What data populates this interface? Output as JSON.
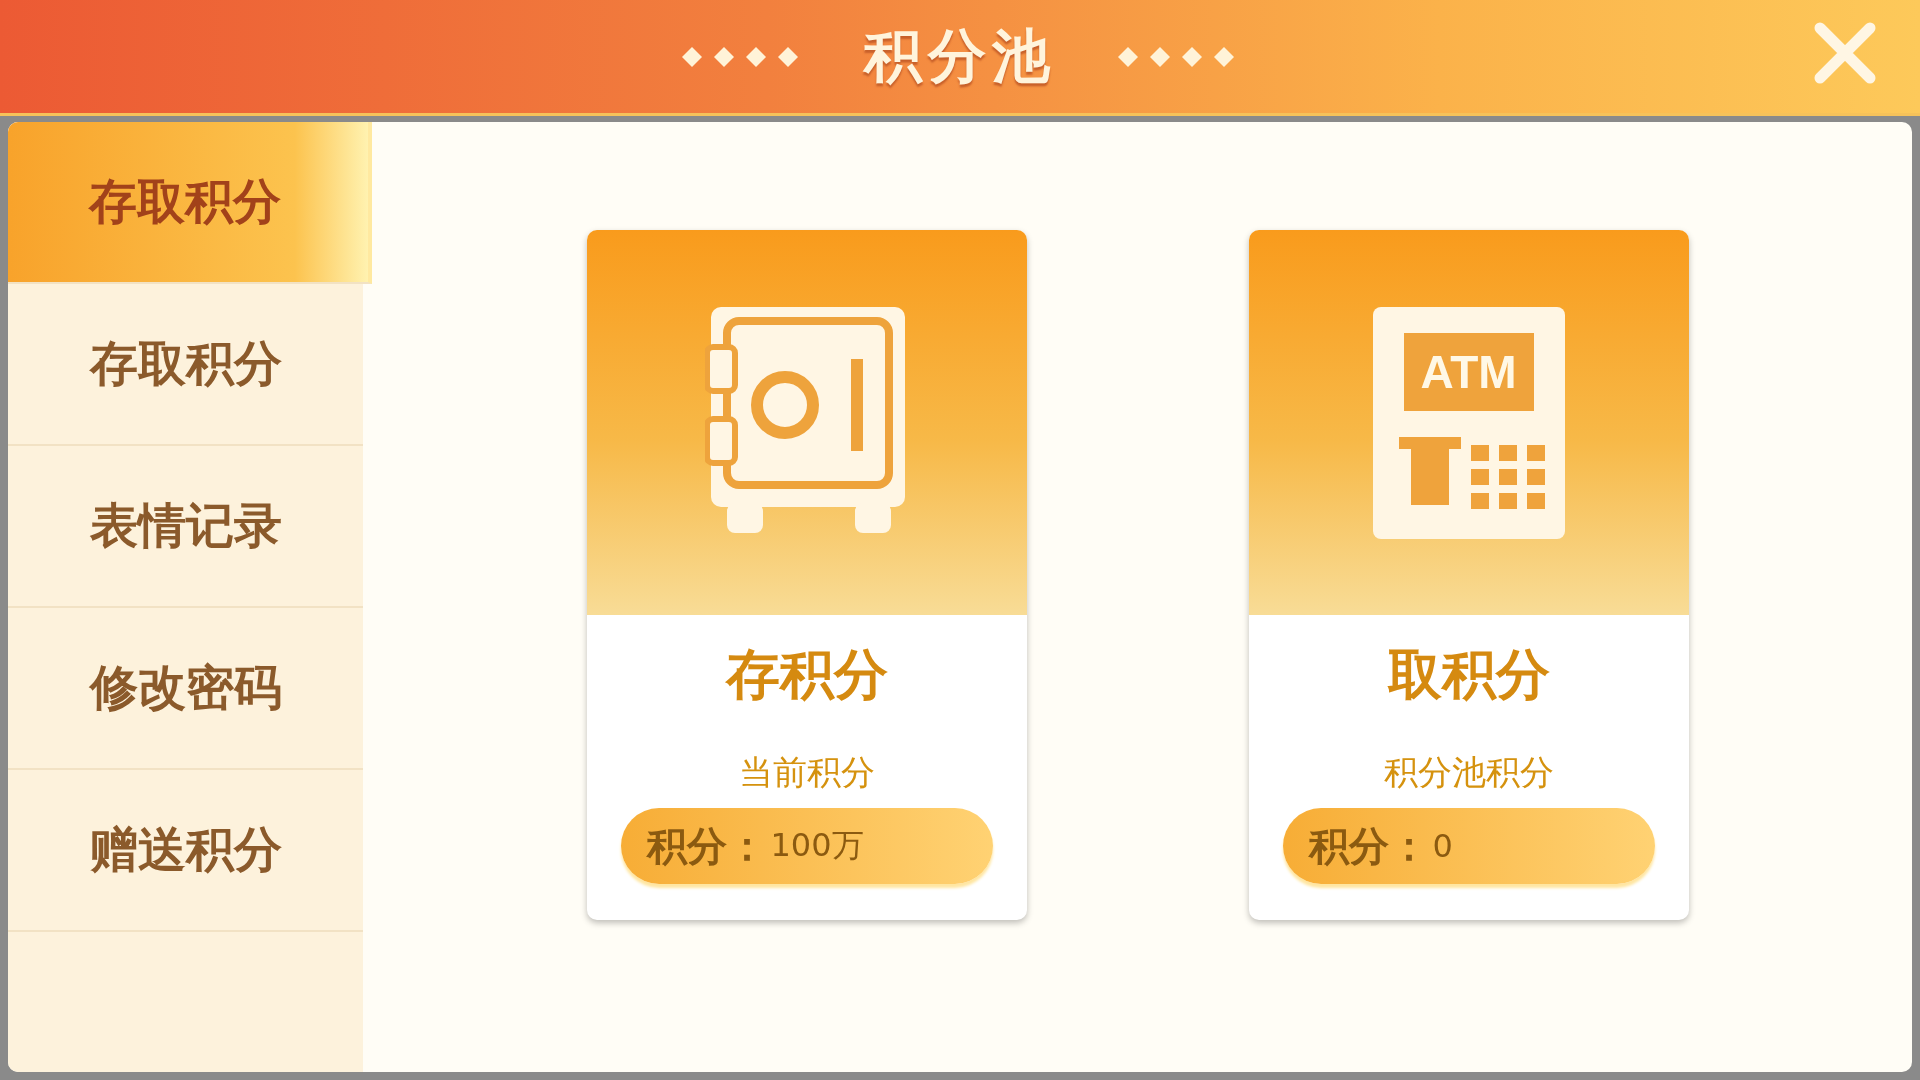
{
  "header": {
    "title": "积分池"
  },
  "sidebar": {
    "items": [
      {
        "label": "存取积分",
        "selected": true
      },
      {
        "label": "存取积分",
        "selected": false
      },
      {
        "label": "表情记录",
        "selected": false
      },
      {
        "label": "修改密码",
        "selected": false
      },
      {
        "label": "赠送积分",
        "selected": false
      }
    ]
  },
  "cards": [
    {
      "kind": "safe",
      "title": "存积分",
      "subtitle": "当前积分",
      "points_label": "积分：",
      "points_value": "100万"
    },
    {
      "kind": "atm",
      "icon_label": "ATM",
      "title": "取积分",
      "subtitle": "积分池积分",
      "points_label": "积分：",
      "points_value": "0"
    }
  ]
}
